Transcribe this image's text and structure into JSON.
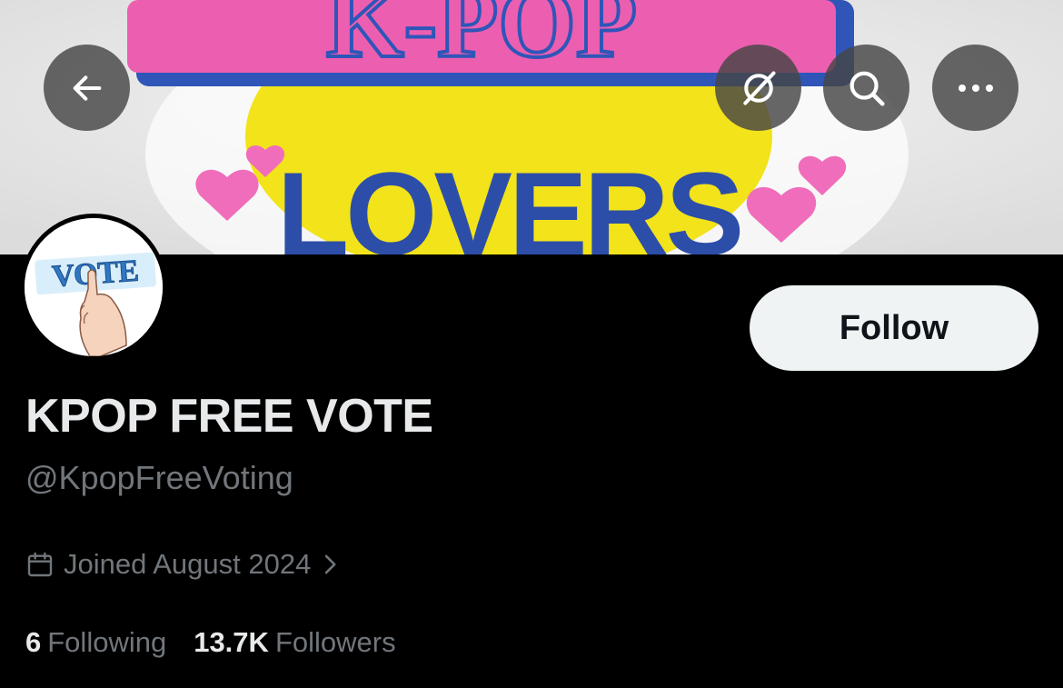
{
  "profile": {
    "display_name": "KPOP FREE VOTE",
    "handle": "@KpopFreeVoting",
    "joined": "Joined August 2024",
    "following_count": "6",
    "following_label": "Following",
    "followers_count": "13.7K",
    "followers_label": "Followers"
  },
  "actions": {
    "follow_label": "Follow"
  },
  "banner": {
    "text_top": "K-POP",
    "text_bottom": "LOVERS"
  },
  "avatar": {
    "text": "VOTE"
  },
  "icons": {
    "back": "arrow-left-icon",
    "grok": "grok-icon",
    "search": "search-icon",
    "more": "more-dots-icon",
    "calendar": "calendar-icon",
    "chevron": "chevron-right-icon"
  },
  "colors": {
    "background": "#000000",
    "primary_text": "#e7e9ea",
    "secondary_text": "#71767b",
    "follow_button_bg": "#eff3f4"
  }
}
